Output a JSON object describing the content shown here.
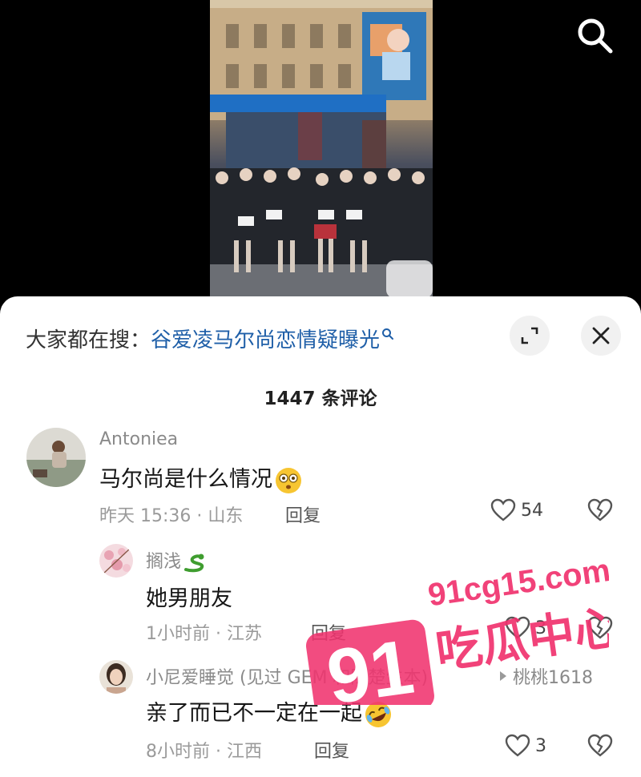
{
  "hot_search": {
    "prefix": "大家都在搜：",
    "query": "谷爱凌马尔尚恋情疑曝光"
  },
  "comment_count": "1447 条评论",
  "comments": [
    {
      "username": "Antoniea",
      "text": "马尔尚是什么情况",
      "emoji": "flushed-face",
      "time_location": "昨天 15:36 · 山东",
      "reply_label": "回复",
      "likes": "54"
    }
  ],
  "replies": [
    {
      "username": "搁浅",
      "username_emoji": "snake",
      "text": "她男朋友",
      "time_location": "1小时前 · 江苏",
      "reply_label": "回复",
      "likes": "3"
    },
    {
      "username": "小尼爱睡觉 (见过 GEM 和陈楚生本)",
      "reply_to": "桃桃1618",
      "text": "亲了而已不一定在一起",
      "emoji": "rolling-laughing-face",
      "time_location": "8小时前 · 江西",
      "reply_label": "回复",
      "likes": "3"
    }
  ],
  "watermark": {
    "number": "91",
    "site": "91cg15.com",
    "name": "吃瓜中心"
  },
  "colors": {
    "link_blue": "#1f5fa8",
    "watermark_pink": "#f0336e"
  }
}
